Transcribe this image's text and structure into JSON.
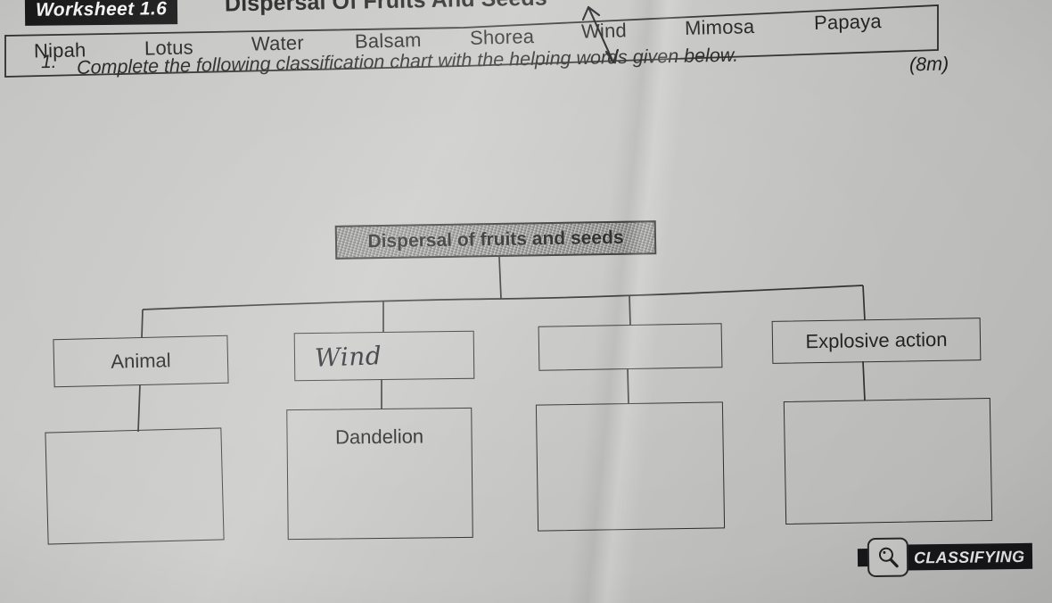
{
  "header": {
    "worksheet_tag": "Worksheet 1.6",
    "title": "Dispersal Of Fruits And Seeds"
  },
  "question": {
    "number": "1.",
    "text": "Complete the following classification chart with the helping words given below.",
    "marks": "(8m)"
  },
  "word_bank": {
    "words": [
      "Nipah",
      "Lotus",
      "Water",
      "Balsam",
      "Shorea",
      "Wind",
      "Mimosa",
      "Papaya"
    ],
    "annotated_word": "Wind"
  },
  "chart_data": {
    "type": "diagram",
    "title": "Dispersal of fruits and seeds",
    "root": "Dispersal of fruits and seeds",
    "branches": [
      {
        "method": "Animal",
        "method_filled": true,
        "handwritten": false,
        "example": "",
        "example_filled": false
      },
      {
        "method": "Wind",
        "method_filled": true,
        "handwritten": true,
        "example": "Dandelion",
        "example_filled": true
      },
      {
        "method": "",
        "method_filled": false,
        "handwritten": false,
        "example": "",
        "example_filled": false
      },
      {
        "method": "Explosive action",
        "method_filled": true,
        "handwritten": false,
        "example": "",
        "example_filled": false
      }
    ]
  },
  "badge": {
    "label": "CLASSIFYING",
    "icon": "magnifying-glass-icon"
  },
  "colors": {
    "ink": "#1c1c1c",
    "paper": "#c4c4c2",
    "tag_background": "#17171a",
    "tag_text": "#f2f2f2"
  }
}
